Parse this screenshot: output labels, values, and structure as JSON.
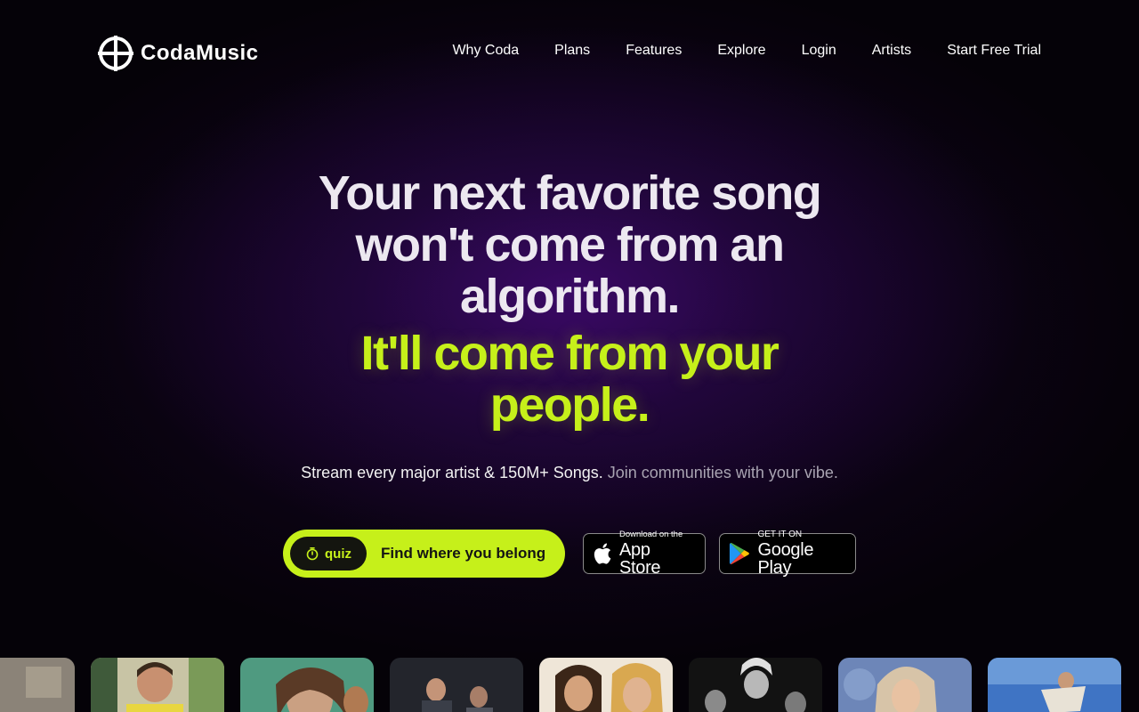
{
  "brand": {
    "name": "CodaMusic",
    "accent_color": "#c6f01a",
    "logo_icon": "coda-logo-icon"
  },
  "nav": {
    "items": [
      {
        "label": "Why Coda"
      },
      {
        "label": "Plans"
      },
      {
        "label": "Features"
      },
      {
        "label": "Explore"
      },
      {
        "label": "Login"
      },
      {
        "label": "Artists"
      },
      {
        "label": "Start Free Trial"
      }
    ]
  },
  "hero": {
    "headline_lines": [
      "Your next favorite song",
      "won't come from an",
      "algorithm."
    ],
    "accent_lines": [
      "It'll come from your",
      "people."
    ],
    "subtitle_main": "Stream every major artist & 150M+ Songs.",
    "subtitle_muted": "Join communities with your vibe."
  },
  "cta": {
    "quiz_tag": "quiz",
    "quiz_icon": "stopwatch-icon",
    "quiz_label": "Find where you belong"
  },
  "stores": {
    "appstore_small": "Download on the",
    "appstore_big": "App Store",
    "appstore_icon": "apple-icon",
    "googleplay_small": "GET IT ON",
    "googleplay_big": "Google Play",
    "googleplay_icon": "google-play-icon"
  },
  "artist_strip": {
    "thumbnails": [
      {
        "name": "artist-thumb-1",
        "color": "#6b6468"
      },
      {
        "name": "artist-thumb-2",
        "color": "#c9c6a8"
      },
      {
        "name": "artist-thumb-3",
        "color": "#4e8f7a"
      },
      {
        "name": "artist-thumb-4",
        "color": "#2c2e35"
      },
      {
        "name": "artist-thumb-5",
        "color": "#d9c9b4"
      },
      {
        "name": "artist-thumb-6",
        "color": "#1a1a1a"
      },
      {
        "name": "artist-thumb-7",
        "color": "#7a8fb8"
      },
      {
        "name": "artist-thumb-8",
        "color": "#4a78c0"
      }
    ]
  }
}
